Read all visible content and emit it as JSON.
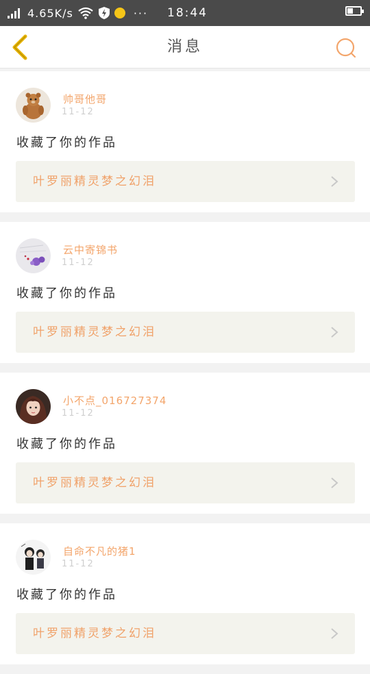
{
  "status_bar": {
    "speed": "4.65K/s",
    "time": "18:44",
    "icons": [
      "signal-icon",
      "wifi-icon",
      "shield-flash-icon",
      "notification-dot-icon",
      "more-dots-icon",
      "battery-icon"
    ],
    "more_label": "···"
  },
  "header": {
    "title": "消息",
    "back_icon": "chevron-left-icon",
    "search_icon": "search-icon"
  },
  "colors": {
    "accent": "#f3a56b",
    "back_arrow": "#e8b400",
    "work_bg": "#f3f3ed"
  },
  "messages": [
    {
      "username": "帅哥他哥",
      "date": "11-12",
      "action": "收藏了你的作品",
      "work_title": "叶罗丽精灵梦之幻泪",
      "avatar_icon": "bear-avatar"
    },
    {
      "username": "云中寄锦书",
      "date": "11-12",
      "action": "收藏了你的作品",
      "work_title": "叶罗丽精灵梦之幻泪",
      "avatar_icon": "flowers-avatar"
    },
    {
      "username": "小不点_016727374",
      "date": "11-12",
      "action": "收藏了你的作品",
      "work_title": "叶罗丽精灵梦之幻泪",
      "avatar_icon": "girl-avatar"
    },
    {
      "username": "自命不凡的猪1",
      "date": "11-12",
      "action": "收藏了你的作品",
      "work_title": "叶罗丽精灵梦之幻泪",
      "avatar_icon": "anime-avatar"
    }
  ]
}
